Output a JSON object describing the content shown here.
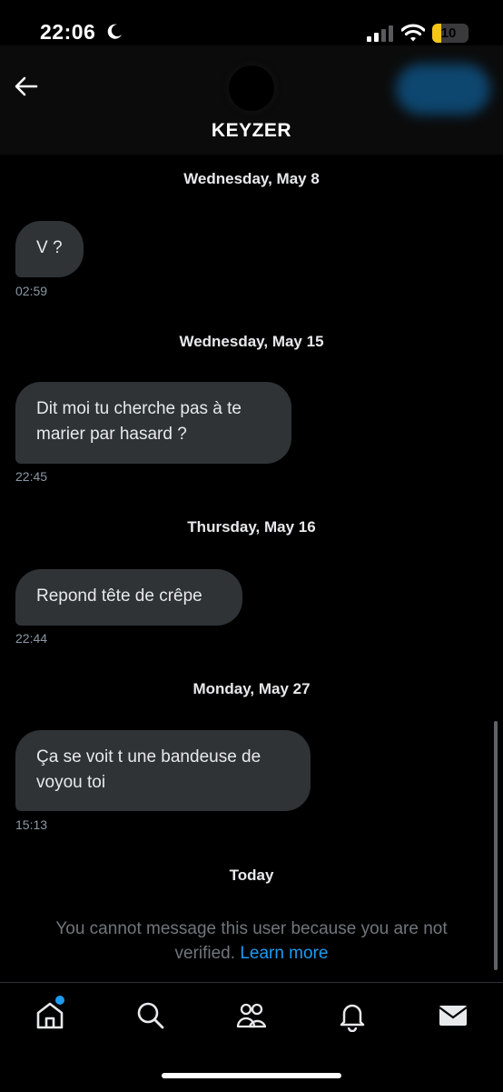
{
  "status_bar": {
    "time": "22:06",
    "battery": "10",
    "battery_level_percent": 10
  },
  "header": {
    "title": "KEYZER",
    "icons": [
      "back-arrow-icon",
      "avatar",
      "follow-button"
    ]
  },
  "conversation": [
    {
      "date": "Wednesday, May 8",
      "text": "V ?",
      "time": "02:59"
    },
    {
      "date": "Wednesday, May 15",
      "text": "Dit moi tu cherche pas à te marier par hasard ?",
      "time": "22:45"
    },
    {
      "date": "Thursday, May 16",
      "text": "Repond tête de crêpe",
      "time": "22:44"
    },
    {
      "date": "Monday, May 27",
      "text": "Ça se voit t une bandeuse de voyou toi",
      "time": "15:13"
    }
  ],
  "today_label": "Today",
  "notice": {
    "text": "You cannot message this user because you are not verified. ",
    "link": "Learn more"
  },
  "bottom_nav": {
    "items": [
      "home-icon",
      "search-icon",
      "communities-icon",
      "notifications-icon",
      "messages-icon"
    ]
  },
  "colors": {
    "bubble": "#2f3336",
    "link": "#1d9bf0",
    "battery": "#f5c518"
  }
}
